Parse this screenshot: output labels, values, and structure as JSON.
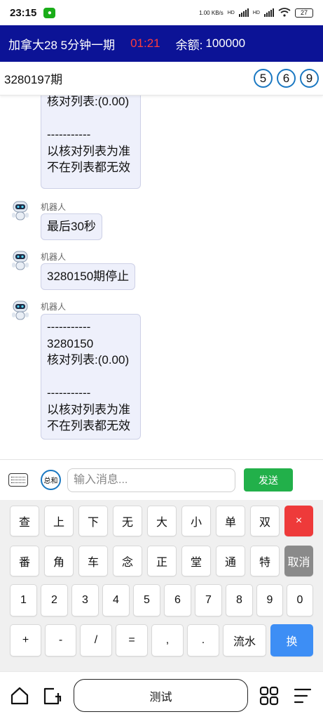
{
  "status": {
    "time": "23:15",
    "wechat_icon": "wechat-icon",
    "net_speed": "1.00 KB/s",
    "hd1": "HD",
    "hd2": "HD",
    "battery": "27"
  },
  "header": {
    "game": "加拿大28 5分钟一期",
    "countdown": "01:21",
    "balance_label": "余额:",
    "balance": "100000",
    "countdown_color": "#ff3b3b",
    "bg_color": "#0c1396"
  },
  "period": {
    "current": "3280197期",
    "balls": [
      "5",
      "6",
      "9"
    ]
  },
  "chat": {
    "messages": [
      {
        "sender": "",
        "text": "核对列表:(0.00)\n\n-----------\n以核对列表为准\n不在列表都无效"
      },
      {
        "sender": "机器人",
        "text": "最后30秒"
      },
      {
        "sender": "机器人",
        "text": "3280150期停止"
      },
      {
        "sender": "机器人",
        "text": "-----------\n3280150\n核对列表:(0.00)\n\n-----------\n以核对列表为准\n不在列表都无效"
      }
    ]
  },
  "input": {
    "sum_label": "总和",
    "placeholder": "输入消息...",
    "send_label": "发送"
  },
  "keypad": {
    "row1": [
      "查",
      "上",
      "下",
      "无",
      "大",
      "小",
      "单",
      "双",
      "×"
    ],
    "row2": [
      "番",
      "角",
      "车",
      "念",
      "正",
      "堂",
      "通",
      "特",
      "取消"
    ],
    "row3": [
      "1",
      "2",
      "3",
      "4",
      "5",
      "6",
      "7",
      "8",
      "9",
      "0"
    ],
    "row4": [
      "+",
      "-",
      "/",
      "=",
      ",",
      ".",
      "流水",
      "换"
    ],
    "colors": {
      "delete": "#ee3a3a",
      "cancel": "#8a8a8a",
      "switch": "#3d8ef5"
    }
  },
  "nav": {
    "test_label": "测试",
    "icons": [
      "home-icon",
      "share-icon",
      "apps-grid-icon",
      "menu-icon"
    ]
  }
}
